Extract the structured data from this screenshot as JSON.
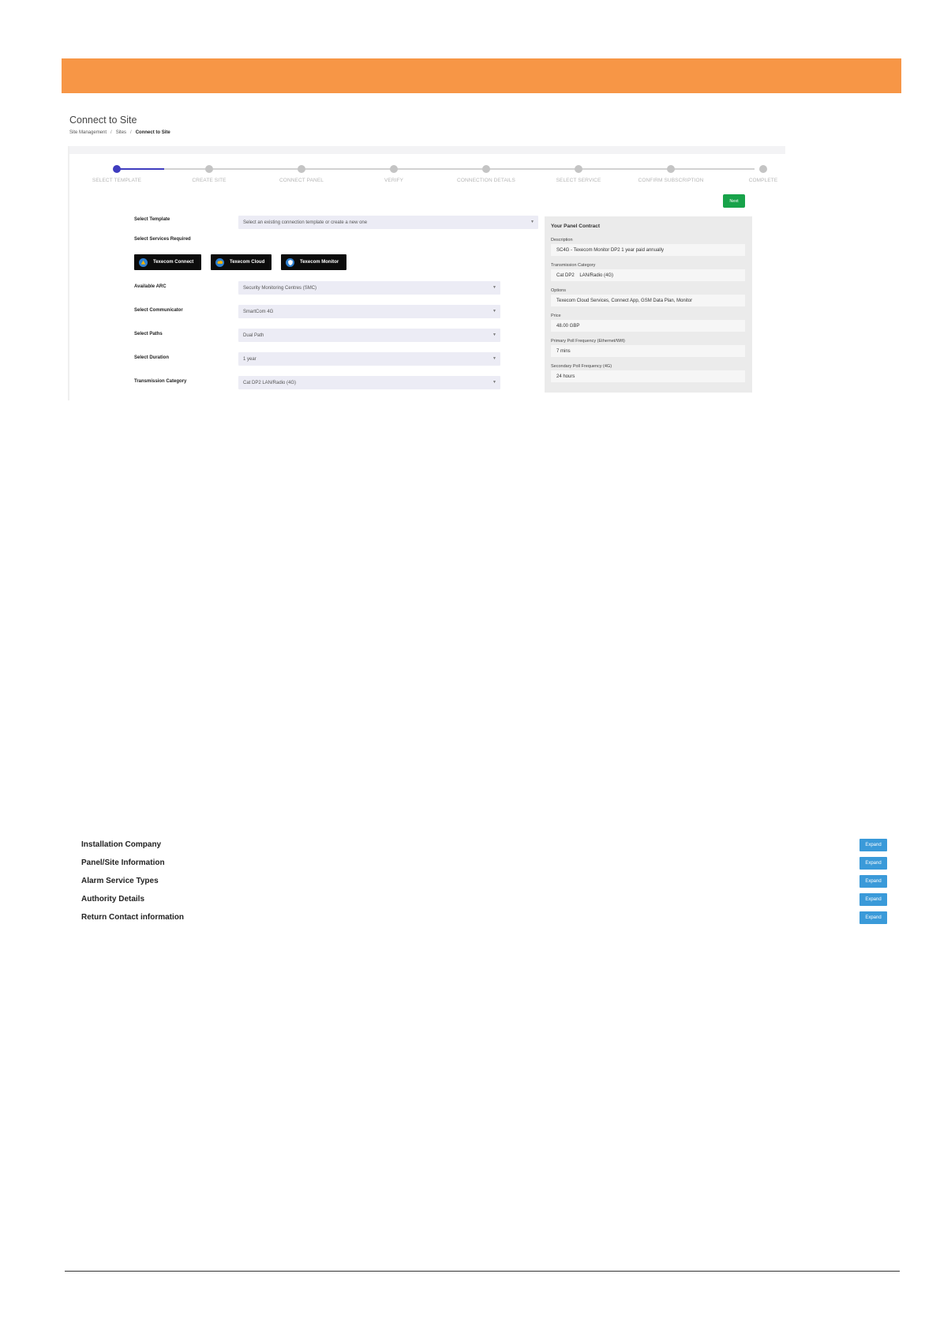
{
  "page": {
    "title": "Connect to Site",
    "breadcrumb": [
      "Site Management",
      "Sites",
      "Connect to Site"
    ],
    "brand_color": "#f79646"
  },
  "stepper": {
    "steps": [
      "SELECT TEMPLATE",
      "CREATE SITE",
      "CONNECT PANEL",
      "VERIFY",
      "CONNECTION DETAILS",
      "SELECT SERVICE",
      "CONFIRM SUBSCRIPTION",
      "COMPLETE"
    ],
    "active_index": 0,
    "accent": "#3f3cbf"
  },
  "next_label": "Next",
  "form": {
    "select_template_label": "Select Template",
    "select_template_placeholder": "Select an existing connection template or create a new one",
    "services_label": "Select Services Required",
    "services": [
      {
        "label": "Texecom Connect",
        "icon": "texecom-connect-icon"
      },
      {
        "label": "Texecom Cloud",
        "icon": "texecom-cloud-icon"
      },
      {
        "label": "Texecom Monitor",
        "icon": "texecom-monitor-icon"
      }
    ],
    "arc_label": "Available ARC",
    "arc_value": "Security Monitoring Centres (SMC)",
    "communicator_label": "Select Communicator",
    "communicator_value": "SmartCom 4G",
    "paths_label": "Select Paths",
    "paths_value": "Dual Path",
    "duration_label": "Select Duration",
    "duration_value": "1 year",
    "transmission_label": "Transmission Category",
    "transmission_value": "Cat DP2 LAN/Radio (4G)"
  },
  "contract": {
    "title": "Your Panel Contract",
    "description_label": "Description",
    "description": "SC4G - Texecom Monitor DP2 1 year paid annually",
    "transmission_label": "Transmission Category",
    "transmission": "Cat DP2    LAN/Radio (4G)",
    "options_label": "Options",
    "options": "Texecom Cloud Services, Connect App, GSM Data Plan, Monitor",
    "price_label": "Price",
    "price": "48.00 GBP",
    "primary_label": "Primary Poll Frequency (Ethernet/Wifi)",
    "primary": "7 mins",
    "secondary_label": "Secondary Poll Frequency (4G)",
    "secondary": "24 hours"
  },
  "accordion": {
    "expand_label": "Expand",
    "sections": [
      "Installation Company",
      "Panel/Site Information",
      "Alarm Service Types",
      "Authority Details",
      "Return Contact information"
    ]
  }
}
